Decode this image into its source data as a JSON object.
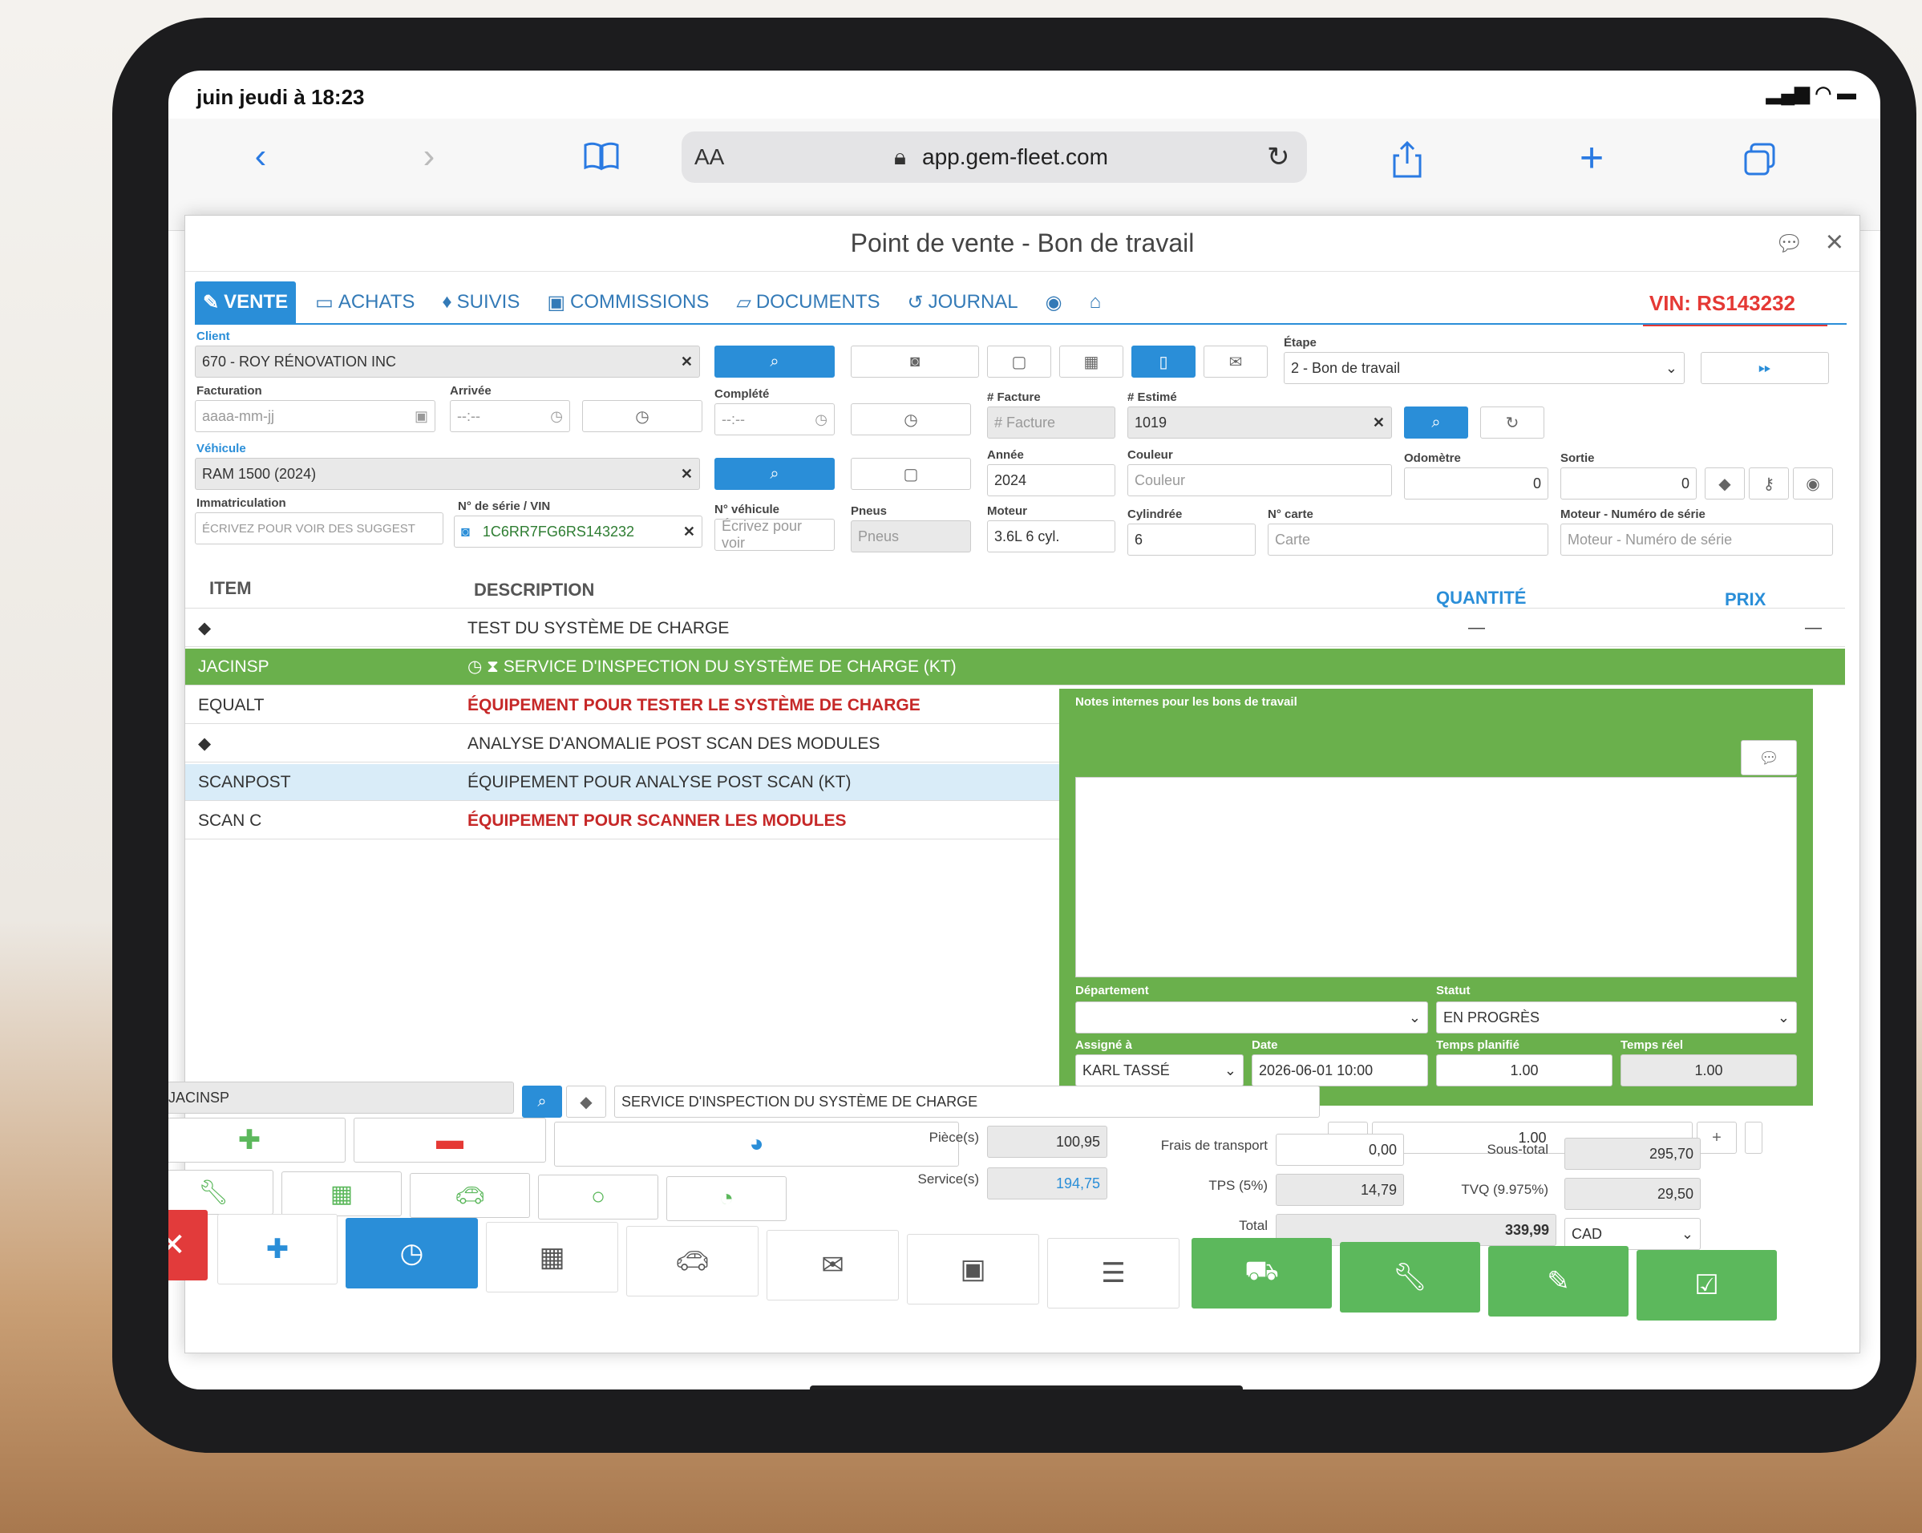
{
  "status_bar": {
    "time": "juin jeudi à 18:23"
  },
  "browser": {
    "aa": "AA",
    "url": "app.gem-fleet.com"
  },
  "app": {
    "title": "Point de vente - Bon de travail",
    "vin_badge": "VIN: RS143232",
    "tabs": [
      "VENTE",
      "ACHATS",
      "SUIVIS",
      "COMMISSIONS",
      "DOCUMENTS",
      "JOURNAL"
    ],
    "client": {
      "label": "Client",
      "value": "670 - ROY RÉNOVATION INC"
    },
    "facturation": {
      "label": "Facturation",
      "placeholder": "aaaa-mm-jj"
    },
    "arrivee": {
      "label": "Arrivée",
      "placeholder": "--:--"
    },
    "complete": {
      "label": "Complété",
      "placeholder": "--:--"
    },
    "facture": {
      "label": "# Facture",
      "placeholder": "# Facture"
    },
    "estime": {
      "label": "# Estimé",
      "value": "1019"
    },
    "etape": {
      "label": "Étape",
      "value": "2 - Bon de travail"
    },
    "vehicule": {
      "label": "Véhicule",
      "value": "RAM 1500 (2024)"
    },
    "annee": {
      "label": "Année",
      "value": "2024"
    },
    "couleur": {
      "label": "Couleur",
      "placeholder": "Couleur"
    },
    "odometre": {
      "label": "Odomètre",
      "value": "0"
    },
    "sortie": {
      "label": "Sortie",
      "value": "0"
    },
    "immatriculation": {
      "label": "Immatriculation",
      "placeholder": "ÉCRIVEZ POUR VOIR DES SUGGEST"
    },
    "vin": {
      "label": "N° de série / VIN",
      "value": "1C6RR7FG6RS143232"
    },
    "no_vehicule": {
      "label": "N° véhicule",
      "placeholder": "Écrivez pour voir"
    },
    "pneus": {
      "label": "Pneus",
      "placeholder": "Pneus"
    },
    "moteur": {
      "label": "Moteur",
      "value": "3.6L 6 cyl."
    },
    "cylindree": {
      "label": "Cylindrée",
      "value": "6"
    },
    "no_carte": {
      "label": "N° carte",
      "placeholder": "Carte"
    },
    "moteur_serie": {
      "label": "Moteur - Numéro de série",
      "placeholder": "Moteur - Numéro de série"
    }
  },
  "table": {
    "headers": {
      "item": "ITEM",
      "description": "DESCRIPTION",
      "quantite": "QUANTITÉ",
      "prix": "PRIX"
    },
    "dash": "—",
    "rows": [
      {
        "item": "",
        "description": "TEST DU SYSTÈME DE CHARGE"
      },
      {
        "item": "JACINSP",
        "description": "SERVICE D'INSPECTION DU SYSTÈME DE CHARGE (KT)"
      },
      {
        "item": "EQUALT",
        "description": "ÉQUIPEMENT POUR TESTER LE SYSTÈME DE CHARGE"
      },
      {
        "item": "",
        "description": "ANALYSE D'ANOMALIE POST SCAN DES MODULES"
      },
      {
        "item": "SCANPOST",
        "description": "ÉQUIPEMENT POUR ANALYSE POST SCAN (KT)"
      },
      {
        "item": "SCAN C",
        "description": "ÉQUIPEMENT POUR SCANNER LES MODULES"
      }
    ]
  },
  "notes": {
    "title": "Notes internes pour les bons de travail",
    "departement": {
      "label": "Département",
      "value": ""
    },
    "statut": {
      "label": "Statut",
      "value": "EN PROGRÈS"
    },
    "assigne": {
      "label": "Assigné à",
      "value": "KARL TASSÉ"
    },
    "date": {
      "label": "Date",
      "value": "2026-06-01 10:00"
    },
    "temps_planifie": {
      "label": "Temps planifié",
      "value": "1.00"
    },
    "temps_reel": {
      "label": "Temps réel",
      "value": "1.00"
    }
  },
  "line_edit": {
    "code": "JACINSP",
    "description": "SERVICE D'INSPECTION DU SYSTÈME DE CHARGE",
    "qty": "1.00",
    "minus": "-",
    "plus": "+"
  },
  "totals": {
    "pieces_label": "Pièce(s)",
    "pieces": "100,95",
    "service_label": "Service(s)",
    "service": "194,75",
    "frais_label": "Frais de transport",
    "frais": "0,00",
    "tps_label": "TPS (5%)",
    "tps": "14,79",
    "total_label": "Total",
    "total": "339,99",
    "sous_total_label": "Sous-total",
    "sous_total": "295,70",
    "tvq_label": "TVQ (9.975%)",
    "tvq": "29,50",
    "currency": "CAD"
  }
}
